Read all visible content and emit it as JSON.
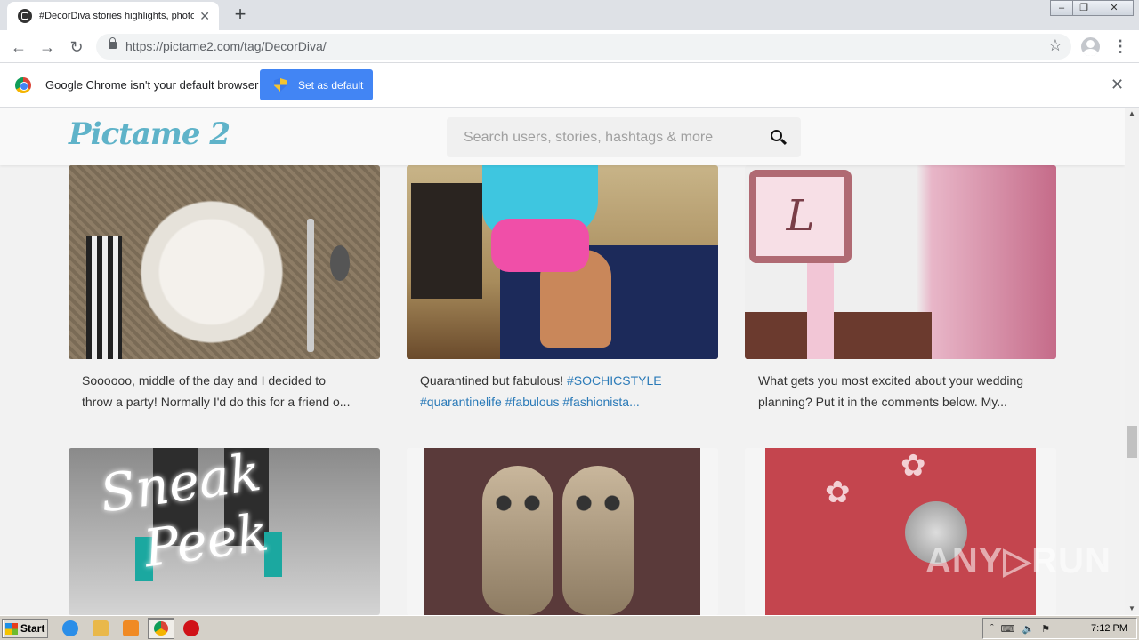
{
  "browser": {
    "tab_title": "#DecorDiva stories highlights, photo",
    "tab_close": "✕",
    "new_tab": "+",
    "url_host": "https://pictame2.com",
    "url_path": "/tag/DecorDiva/",
    "back": "←",
    "forward": "→",
    "reload": "↻",
    "star": "☆",
    "menu": "⋮",
    "window_buttons": {
      "minimize": "–",
      "restore": "❐",
      "close": "✕"
    }
  },
  "infobar": {
    "message": "Google Chrome isn't your default browser",
    "button_label": "Set as default",
    "close": "✕"
  },
  "site": {
    "logo": "Pictame 2",
    "search_placeholder": "Search users, stories, hashtags & more"
  },
  "posts": [
    {
      "caption_lines": [
        "Soooooo, middle of the day and I decided to",
        "throw a party! Normally I'd do this for a friend o..."
      ]
    },
    {
      "caption_text": "Quarantined but fabulous! ",
      "caption_tags": [
        "#SOCHICSTYLE",
        "#quarantinelife",
        "#fabulous",
        "#fashionista..."
      ]
    },
    {
      "caption_lines": [
        "What gets you most excited about your wedding",
        "planning? Put it in the comments below. My..."
      ]
    },
    {
      "image_text": [
        "Sneak",
        "Peek"
      ]
    },
    {},
    {}
  ],
  "watermark": "ANY▷RUN",
  "scrollbar": {
    "up": "▲",
    "down": "▼"
  },
  "taskbar": {
    "start_label": "Start",
    "tray_icons": [
      "ˆ",
      "⌨",
      "🔈",
      "⚑"
    ],
    "clock": "7:12 PM"
  }
}
